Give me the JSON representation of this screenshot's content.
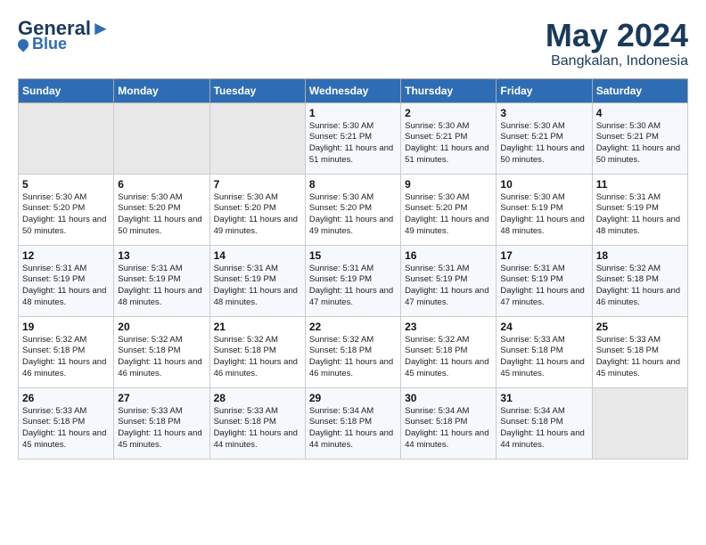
{
  "header": {
    "logo_line1": "General",
    "logo_line2": "Blue",
    "month": "May 2024",
    "location": "Bangkalan, Indonesia"
  },
  "days_of_week": [
    "Sunday",
    "Monday",
    "Tuesday",
    "Wednesday",
    "Thursday",
    "Friday",
    "Saturday"
  ],
  "weeks": [
    [
      {
        "day": "",
        "info": ""
      },
      {
        "day": "",
        "info": ""
      },
      {
        "day": "",
        "info": ""
      },
      {
        "day": "1",
        "info": "Sunrise: 5:30 AM\nSunset: 5:21 PM\nDaylight: 11 hours and 51 minutes."
      },
      {
        "day": "2",
        "info": "Sunrise: 5:30 AM\nSunset: 5:21 PM\nDaylight: 11 hours and 51 minutes."
      },
      {
        "day": "3",
        "info": "Sunrise: 5:30 AM\nSunset: 5:21 PM\nDaylight: 11 hours and 50 minutes."
      },
      {
        "day": "4",
        "info": "Sunrise: 5:30 AM\nSunset: 5:21 PM\nDaylight: 11 hours and 50 minutes."
      }
    ],
    [
      {
        "day": "5",
        "info": "Sunrise: 5:30 AM\nSunset: 5:20 PM\nDaylight: 11 hours and 50 minutes."
      },
      {
        "day": "6",
        "info": "Sunrise: 5:30 AM\nSunset: 5:20 PM\nDaylight: 11 hours and 50 minutes."
      },
      {
        "day": "7",
        "info": "Sunrise: 5:30 AM\nSunset: 5:20 PM\nDaylight: 11 hours and 49 minutes."
      },
      {
        "day": "8",
        "info": "Sunrise: 5:30 AM\nSunset: 5:20 PM\nDaylight: 11 hours and 49 minutes."
      },
      {
        "day": "9",
        "info": "Sunrise: 5:30 AM\nSunset: 5:20 PM\nDaylight: 11 hours and 49 minutes."
      },
      {
        "day": "10",
        "info": "Sunrise: 5:30 AM\nSunset: 5:19 PM\nDaylight: 11 hours and 48 minutes."
      },
      {
        "day": "11",
        "info": "Sunrise: 5:31 AM\nSunset: 5:19 PM\nDaylight: 11 hours and 48 minutes."
      }
    ],
    [
      {
        "day": "12",
        "info": "Sunrise: 5:31 AM\nSunset: 5:19 PM\nDaylight: 11 hours and 48 minutes."
      },
      {
        "day": "13",
        "info": "Sunrise: 5:31 AM\nSunset: 5:19 PM\nDaylight: 11 hours and 48 minutes."
      },
      {
        "day": "14",
        "info": "Sunrise: 5:31 AM\nSunset: 5:19 PM\nDaylight: 11 hours and 48 minutes."
      },
      {
        "day": "15",
        "info": "Sunrise: 5:31 AM\nSunset: 5:19 PM\nDaylight: 11 hours and 47 minutes."
      },
      {
        "day": "16",
        "info": "Sunrise: 5:31 AM\nSunset: 5:19 PM\nDaylight: 11 hours and 47 minutes."
      },
      {
        "day": "17",
        "info": "Sunrise: 5:31 AM\nSunset: 5:19 PM\nDaylight: 11 hours and 47 minutes."
      },
      {
        "day": "18",
        "info": "Sunrise: 5:32 AM\nSunset: 5:18 PM\nDaylight: 11 hours and 46 minutes."
      }
    ],
    [
      {
        "day": "19",
        "info": "Sunrise: 5:32 AM\nSunset: 5:18 PM\nDaylight: 11 hours and 46 minutes."
      },
      {
        "day": "20",
        "info": "Sunrise: 5:32 AM\nSunset: 5:18 PM\nDaylight: 11 hours and 46 minutes."
      },
      {
        "day": "21",
        "info": "Sunrise: 5:32 AM\nSunset: 5:18 PM\nDaylight: 11 hours and 46 minutes."
      },
      {
        "day": "22",
        "info": "Sunrise: 5:32 AM\nSunset: 5:18 PM\nDaylight: 11 hours and 46 minutes."
      },
      {
        "day": "23",
        "info": "Sunrise: 5:32 AM\nSunset: 5:18 PM\nDaylight: 11 hours and 45 minutes."
      },
      {
        "day": "24",
        "info": "Sunrise: 5:33 AM\nSunset: 5:18 PM\nDaylight: 11 hours and 45 minutes."
      },
      {
        "day": "25",
        "info": "Sunrise: 5:33 AM\nSunset: 5:18 PM\nDaylight: 11 hours and 45 minutes."
      }
    ],
    [
      {
        "day": "26",
        "info": "Sunrise: 5:33 AM\nSunset: 5:18 PM\nDaylight: 11 hours and 45 minutes."
      },
      {
        "day": "27",
        "info": "Sunrise: 5:33 AM\nSunset: 5:18 PM\nDaylight: 11 hours and 45 minutes."
      },
      {
        "day": "28",
        "info": "Sunrise: 5:33 AM\nSunset: 5:18 PM\nDaylight: 11 hours and 44 minutes."
      },
      {
        "day": "29",
        "info": "Sunrise: 5:34 AM\nSunset: 5:18 PM\nDaylight: 11 hours and 44 minutes."
      },
      {
        "day": "30",
        "info": "Sunrise: 5:34 AM\nSunset: 5:18 PM\nDaylight: 11 hours and 44 minutes."
      },
      {
        "day": "31",
        "info": "Sunrise: 5:34 AM\nSunset: 5:18 PM\nDaylight: 11 hours and 44 minutes."
      },
      {
        "day": "",
        "info": ""
      }
    ]
  ]
}
